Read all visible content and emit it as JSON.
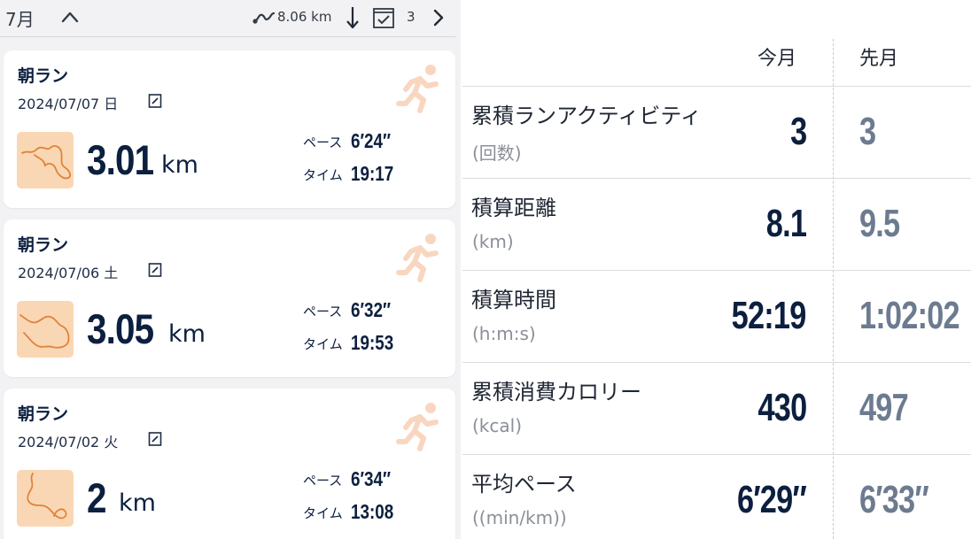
{
  "header": {
    "month": "7月",
    "total_distance": "8.06 km",
    "activity_count": "3"
  },
  "activities": [
    {
      "title": "朝ラン",
      "date": "2024/07/07 日",
      "distance": "3.01",
      "unit": "km",
      "pace_label": "ペース",
      "pace": "6′24″",
      "time_label": "タイム",
      "time": "19:17"
    },
    {
      "title": "朝ラン",
      "date": "2024/07/06 土",
      "distance": "3.05",
      "unit": "km",
      "pace_label": "ペース",
      "pace": "6′32″",
      "time_label": "タイム",
      "time": "19:53"
    },
    {
      "title": "朝ラン",
      "date": "2024/07/02 火",
      "distance": "2",
      "unit": "km",
      "pace_label": "ペース",
      "pace": "6′34″",
      "time_label": "タイム",
      "time": "13:08"
    }
  ],
  "stats": {
    "col_current": "今月",
    "col_previous": "先月",
    "rows": [
      {
        "label": "累積ランアクティビティ",
        "unit": "(回数)",
        "current": "3",
        "previous": "3"
      },
      {
        "label": "積算距離",
        "unit": "(km)",
        "current": "8.1",
        "previous": "9.5"
      },
      {
        "label": "積算時間",
        "unit": "(h:m:s)",
        "current": "52:19",
        "previous": "1:02:02"
      },
      {
        "label": "累積消費カロリー",
        "unit": "(kcal)",
        "current": "430",
        "previous": "497"
      },
      {
        "label": "平均ペース",
        "unit": "((min/km))",
        "current": "6′29″",
        "previous": "6′33″"
      }
    ]
  },
  "colors": {
    "navy": "#0c1f3f",
    "muted_blue": "#6d7b90",
    "route_orange": "#e0823a",
    "thumb_bg": "#fad7b4",
    "runner_orange": "#f3a576"
  },
  "icons": [
    "chevron-up-icon",
    "route-icon",
    "sort-down-icon",
    "checkbox-icon",
    "chevron-right-icon",
    "edit-icon",
    "runner-icon"
  ]
}
